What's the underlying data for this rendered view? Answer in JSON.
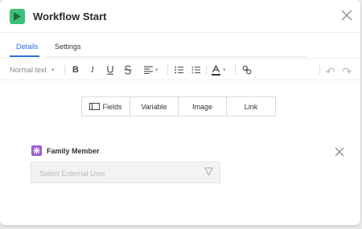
{
  "header": {
    "title": "Workflow Start",
    "icon": "play-icon",
    "accent_color": "#3dbf7a"
  },
  "tabs": [
    {
      "label": "Details",
      "active": true
    },
    {
      "label": "Settings",
      "active": false
    }
  ],
  "toolbar": {
    "text_style": "Normal text",
    "buttons": [
      "bold-icon",
      "italic-icon",
      "underline-icon",
      "strikethrough-icon",
      "align-icon",
      "bullet-list-icon",
      "numbered-list-icon",
      "text-color-icon",
      "link-icon",
      "undo-icon",
      "redo-icon"
    ]
  },
  "insert_buttons": {
    "fields": "Fields",
    "variable": "Variable",
    "image": "Image",
    "link": "Link"
  },
  "family_member": {
    "label": "Family Member",
    "icon_color": "#9b59d0",
    "select_placeholder": "Select External User"
  },
  "colors": {
    "active_tab": "#2a6fd6"
  }
}
